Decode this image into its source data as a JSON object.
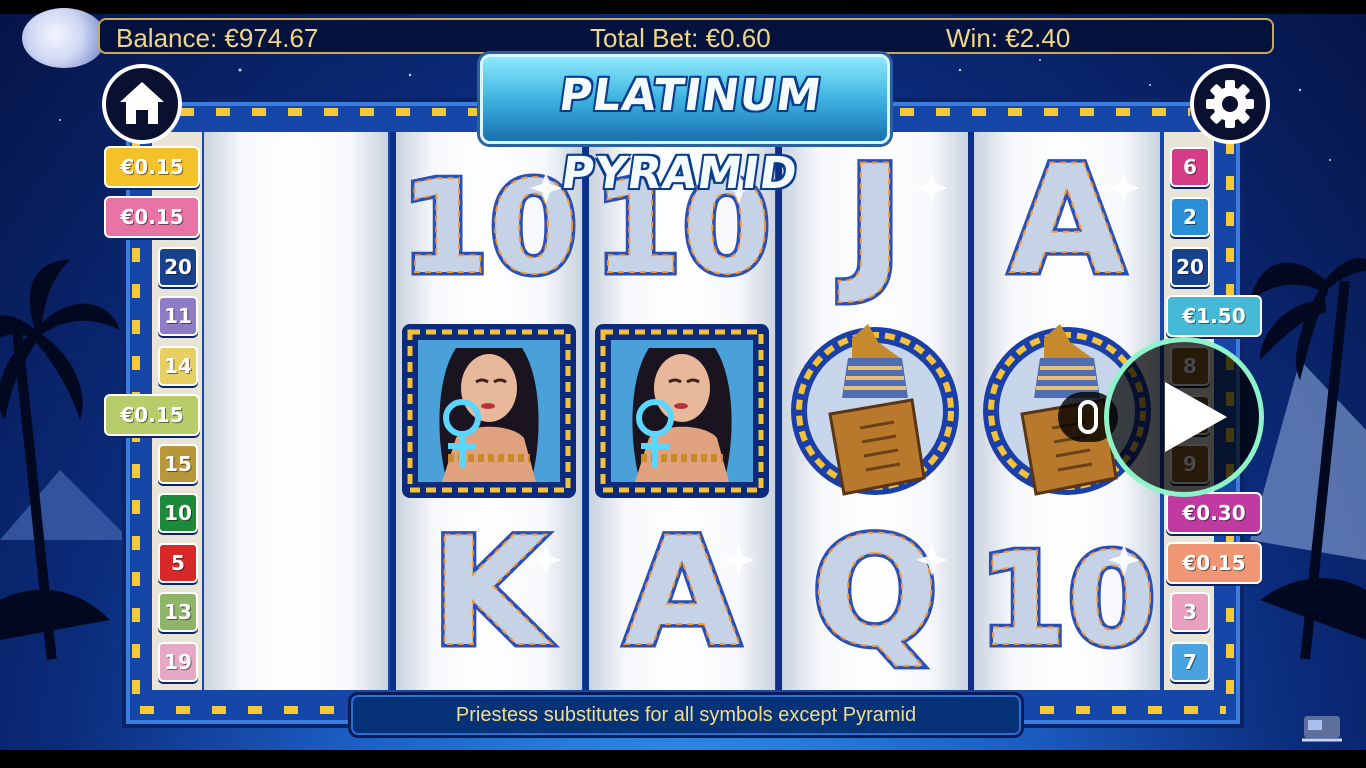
{
  "header": {
    "balance": "Balance: €974.67",
    "total_bet": "Total Bet: €0.60",
    "win": "Win: €2.40"
  },
  "logo": {
    "text": "PLATINUM PYRAMID"
  },
  "buttons": {
    "home": "home-icon",
    "settings": "gear-icon",
    "play": "play-icon"
  },
  "left_lines": [
    {
      "label": "€0.15",
      "color": "#f3c22a",
      "kind": "amount"
    },
    {
      "label": "€0.15",
      "color": "#e874a6",
      "kind": "amount"
    },
    {
      "label": "20",
      "color": "#18418e",
      "kind": "number"
    },
    {
      "label": "11",
      "color": "#8e7cc6",
      "kind": "number"
    },
    {
      "label": "14",
      "color": "#e8cf62",
      "kind": "number"
    },
    {
      "label": "€0.15",
      "color": "#b7cd6a",
      "kind": "amount"
    },
    {
      "label": "15",
      "color": "#b8973b",
      "kind": "number"
    },
    {
      "label": "10",
      "color": "#1d8a3b",
      "kind": "number"
    },
    {
      "label": "5",
      "color": "#d8292a",
      "kind": "number"
    },
    {
      "label": "13",
      "color": "#8fb56a",
      "kind": "number"
    },
    {
      "label": "19",
      "color": "#e7a8c6",
      "kind": "number"
    }
  ],
  "right_lines": [
    {
      "label": "6",
      "color": "#d63c86",
      "kind": "number"
    },
    {
      "label": "2",
      "color": "#2a8fd6",
      "kind": "number"
    },
    {
      "label": "20",
      "color": "#18418e",
      "kind": "number"
    },
    {
      "label": "€1.50",
      "color": "#46b9d7",
      "kind": "amount"
    },
    {
      "label": "8",
      "color": "#8a5f2a",
      "kind": "number"
    },
    {
      "label": "",
      "color": "#6a4f2a",
      "kind": "number"
    },
    {
      "label": "9",
      "color": "#8a5f2a",
      "kind": "number"
    },
    {
      "label": "€0.30",
      "color": "#c13aa2",
      "kind": "amount"
    },
    {
      "label": "€0.15",
      "color": "#ef9674",
      "kind": "amount"
    },
    {
      "label": "3",
      "color": "#e9a0c0",
      "kind": "number"
    },
    {
      "label": "7",
      "color": "#4aa3e0",
      "kind": "number"
    }
  ],
  "reels": [
    [
      "blank",
      "blank",
      "blank"
    ],
    [
      "10",
      "priestess",
      "K"
    ],
    [
      "10",
      "priestess",
      "A"
    ],
    [
      "J",
      "canopic-jar",
      "Q"
    ],
    [
      "A",
      "canopic-jar",
      "10"
    ]
  ],
  "message": "Priestess substitutes for all symbols except Pyramid"
}
